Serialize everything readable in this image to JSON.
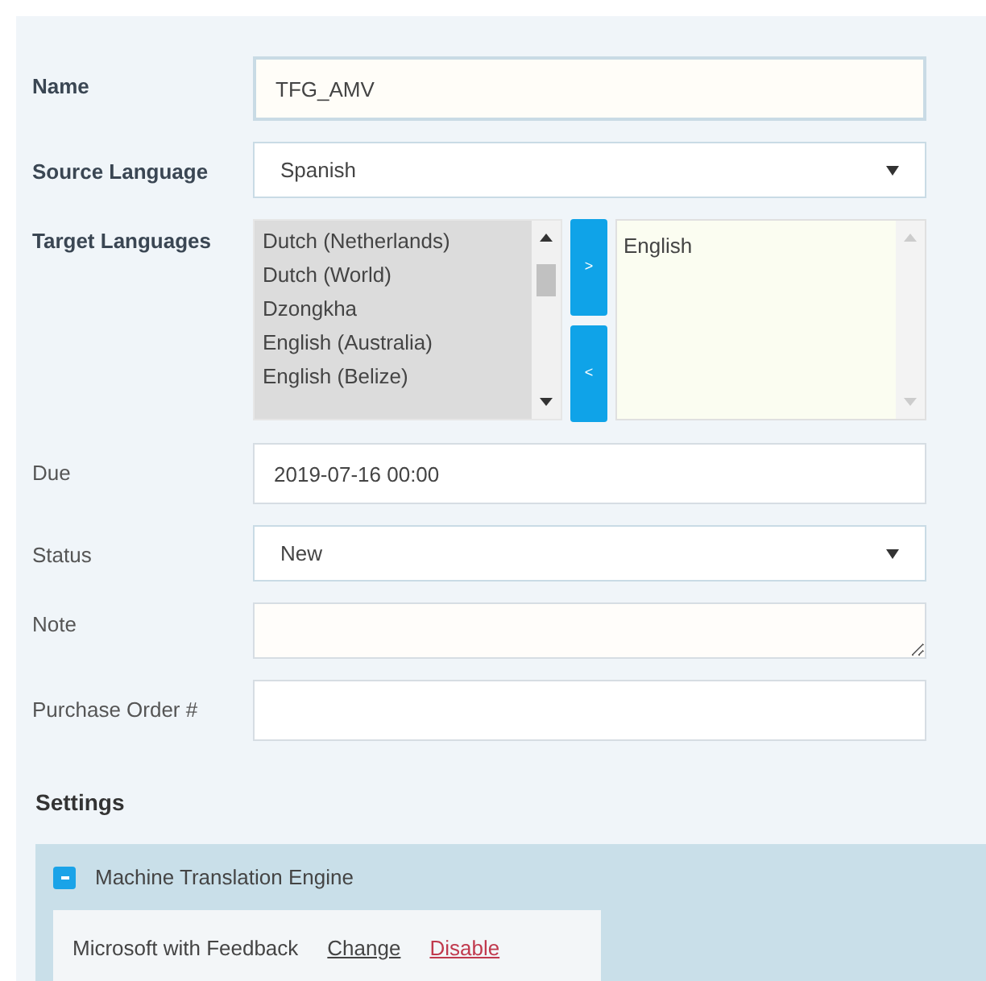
{
  "fields": [
    {
      "kind": "text",
      "label": "Name",
      "bold": true,
      "value": "TFG_AMV"
    },
    {
      "kind": "select",
      "label": "Source Language",
      "bold": true,
      "value": "Spanish"
    },
    {
      "kind": "dual-list",
      "label": "Target Languages",
      "bold": true,
      "available": [
        "Dutch (Netherlands)",
        "Dutch (World)",
        "Dzongkha",
        "English (Australia)",
        "English (Belize)"
      ],
      "add": ">",
      "remove": "<",
      "chosen": [
        "English"
      ]
    },
    {
      "kind": "text",
      "label": "Due",
      "bold": false,
      "value": "2019-07-16 00:00"
    },
    {
      "kind": "select",
      "label": "Status",
      "bold": false,
      "value": "New"
    },
    {
      "kind": "textarea",
      "label": "Note",
      "bold": false
    },
    {
      "kind": "text",
      "label": "Purchase Order #",
      "bold": false
    }
  ],
  "settings": {
    "title": "Settings",
    "section": {
      "title": "Machine Translation Engine",
      "expanded": true,
      "engine": "Microsoft with Feedback",
      "links": [
        {
          "label": "Change",
          "kind": "normal"
        },
        {
          "label": "Disable",
          "kind": "danger"
        }
      ]
    }
  }
}
